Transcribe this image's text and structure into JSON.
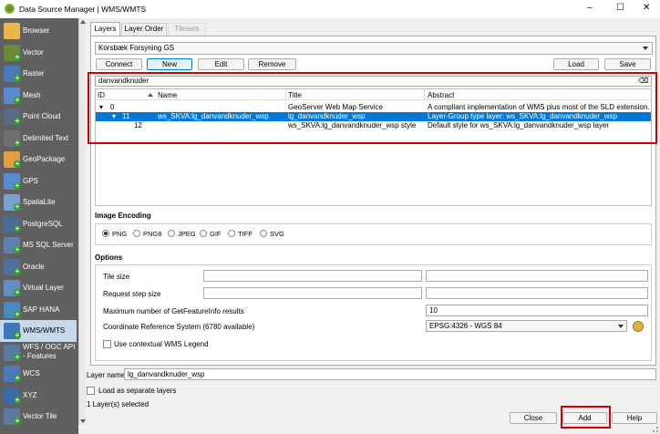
{
  "window": {
    "title": "Data Source Manager | WMS/WMTS",
    "minimize": "–",
    "maximize": "☐",
    "close": "✕"
  },
  "sidebar": {
    "items": [
      {
        "label": "Browser",
        "icon": "folder-icon",
        "color": "#e8b84a"
      },
      {
        "label": "Vector",
        "icon": "vector-icon",
        "color": "#6a8a3a"
      },
      {
        "label": "Raster",
        "icon": "raster-icon",
        "color": "#4a7ab8"
      },
      {
        "label": "Mesh",
        "icon": "mesh-icon",
        "color": "#5a8ad0"
      },
      {
        "label": "Point Cloud",
        "icon": "point-cloud-icon",
        "color": "#5a6a80"
      },
      {
        "label": "Delimited Text",
        "icon": "delimited-text-icon",
        "color": "#707070"
      },
      {
        "label": "GeoPackage",
        "icon": "geopackage-icon",
        "color": "#e0a040"
      },
      {
        "label": "GPS",
        "icon": "gps-icon",
        "color": "#5a8ad0"
      },
      {
        "label": "SpatiaLite",
        "icon": "spatialite-icon",
        "color": "#7aa0d0"
      },
      {
        "label": "PostgreSQL",
        "icon": "postgresql-icon",
        "color": "#4a6a9a"
      },
      {
        "label": "MS SQL Server",
        "icon": "mssql-icon",
        "color": "#6080b0"
      },
      {
        "label": "Oracle",
        "icon": "oracle-icon",
        "color": "#5070a0"
      },
      {
        "label": "Virtual Layer",
        "icon": "virtual-layer-icon",
        "color": "#6090c0"
      },
      {
        "label": "SAP HANA",
        "icon": "sap-hana-icon",
        "color": "#4a8ac0"
      },
      {
        "label": "WMS/WMTS",
        "icon": "wms-icon",
        "color": "#3a7ab8"
      },
      {
        "label": "WFS / OGC API - Features",
        "icon": "wfs-icon",
        "color": "#5a7aa0"
      },
      {
        "label": "WCS",
        "icon": "wcs-icon",
        "color": "#4a7ab8"
      },
      {
        "label": "XYZ",
        "icon": "xyz-icon",
        "color": "#3a6aa8"
      },
      {
        "label": "Vector Tile",
        "icon": "vector-tile-icon",
        "color": "#5a7aa0"
      }
    ],
    "active_index": 14
  },
  "tabs": [
    "Layers",
    "Layer Order",
    "Tilesets"
  ],
  "connection": {
    "selected": "Korsbæk Forsyning GS"
  },
  "buttons": {
    "connect": "Connect",
    "new": "New",
    "edit": "Edit",
    "remove": "Remove",
    "load": "Load",
    "save": "Save"
  },
  "search": {
    "value": "danvandknuder",
    "clear": "⌫"
  },
  "table": {
    "headers": {
      "id": "ID",
      "name": "Name",
      "title": "Title",
      "abstract": "Abstract"
    },
    "rows": [
      {
        "expander": "▾",
        "id": "0",
        "name": "",
        "title": "GeoServer Web Map Service",
        "abstract": "A compliant implementation of WMS plus most of the SLD extension..."
      },
      {
        "expander": "▾",
        "id": "11",
        "name": "ws_SKVA:lg_danvandknuder_wsp",
        "title": "lg_danvandknuder_wsp",
        "abstract": "Layer-Group type layer: ws_SKVA:lg_danvandknuder_wsp"
      },
      {
        "expander": "",
        "id": "12",
        "name": "",
        "title": "ws_SKVA:lg_danvandknuder_wsp style",
        "abstract": "Default style for ws_SKVA:lg_danvandknuder_wsp layer"
      }
    ]
  },
  "image_encoding": {
    "title": "Image Encoding",
    "options": [
      "PNG",
      "PNG8",
      "JPEG",
      "GIF",
      "TIFF",
      "SVG"
    ],
    "selected": "PNG"
  },
  "options": {
    "title": "Options",
    "tile_size": "Tile size",
    "request_step": "Request step size",
    "max_features": "Maximum number of GetFeatureInfo results",
    "max_features_value": "10",
    "crs_label": "Coordinate Reference System (6780 available)",
    "crs_value": "EPSG:4326 - WGS 84",
    "contextual_legend": "Use contextual WMS Legend"
  },
  "layer_name": {
    "label": "Layer name",
    "value": "lg_danvandknuder_wsp"
  },
  "load_separate": "Load as separate layers",
  "status": "1 Layer(s) selected",
  "footer": {
    "close": "Close",
    "add": "Add",
    "help": "Help"
  },
  "colors": {
    "selection": "#0078d7",
    "highlight_box": "#d40000"
  }
}
